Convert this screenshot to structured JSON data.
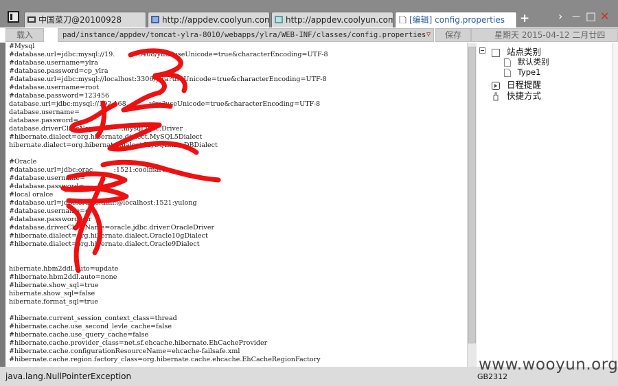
{
  "tabs": [
    {
      "label": "中国菜刀@20100928",
      "active": false
    },
    {
      "label": "http://appdev.coolyun.com/yl...",
      "active": false
    },
    {
      "label": "http://appdev.coolyun.com/yl...",
      "active": false
    },
    {
      "label": "[编辑] config.properties",
      "active": true
    }
  ],
  "window_controls": {
    "add": "+",
    "next": "›",
    "minimize": "—",
    "maximize": "□",
    "close": "✕"
  },
  "toolbar": {
    "load_label": "载入",
    "path": "pad/instance/appdev/tomcat-ylra-8010/webapps/ylra/WEB-INF/classes/config.properties",
    "dropdown_glyph": "▽",
    "save_label": "保存",
    "date_text": "星期天 2015-04-12 二月廿四"
  },
  "editor": {
    "lines": [
      "#Mysql",
      "#database.url=jdbc:mysql://19.          :3408/ylra?useUnicode=true&characterEncoding=UTF-8",
      "#database.username=ylra",
      "#database.password=cp_ylra",
      "#database.url=jdbc:mysql://localhost:3306/ylra?useUnicode=true&characterEncoding=UTF-8",
      "#database.username=root",
      "#database.password=123456",
      "database.url=jdbc:mysql://192.168.          ylra?useUnicode=true&characterEncoding=UTF-8",
      "database.username=",
      "database.password=",
      "database.driverClassName=        .mysql.jdbc.Driver",
      "#hibernate.dialect=org.hibernate.dialect.MySQL5Dialect",
      "hibernate.dialect=org.hibernate.dialect.MySQLInnoDBDialect",
      "",
      "#Oracle",
      "#database.url=jdbc:orac          :1521:coolmart",
      "#database.username=",
      "#database.password=",
      "#local oralce",
      "#database.url=jdbc:oracle:thin:@localhost:1521:yulong",
      "#database.username=dr",
      "#database.password=dr",
      "#database.driverClassName=oracle.jdbc.driver.OracleDriver",
      "#hibernate.dialect=org.hibernate.dialect.Oracle10gDialect",
      "#hibernate.dialect=org.hibernate.dialect.Oracle9Dialect",
      "",
      "",
      "hibernate.hbm2ddl.auto=update",
      "#hibernate.hbm2ddl.auto=none",
      "#hibernate.show_sql=true",
      "hibernate.show_sql=false",
      "hibernate.format_sql=true",
      "",
      "#hibernate.current_session_context_class=thread",
      "#hibernate.cache.use_second_levle_cache=false",
      "#hibernate.cache.use_query_cache=false",
      "#hibernate.cache.provider_class=net.sf.ehcache.hibernate.EhCacheProvider",
      "#hibernate.cache.configurationResourceName=ehcache-failsafe.xml",
      "#hibernate.cache.region.factory_class=org.hibernate.cache.ehcache.EhCacheRegionFactory"
    ]
  },
  "side_tree": {
    "root": "站点类别",
    "children": [
      "默认类别",
      "Type1"
    ],
    "items": [
      "日程提醒",
      "快捷方式"
    ]
  },
  "status": {
    "message": "java.lang.NullPointerException",
    "encoding": "GB2312"
  },
  "watermark": "www.wooyun.org",
  "colors": {
    "scribble": "#ee1111",
    "active_tab_text": "#2b5fa8",
    "close_button": "#e02424",
    "titlebar": "#8a8a8a"
  },
  "icons": [
    "app-window-icon",
    "knife-icon",
    "page-icon",
    "edit-icon",
    "close-icon",
    "folder-icon",
    "calendar-icon",
    "shortcut-icon"
  ]
}
